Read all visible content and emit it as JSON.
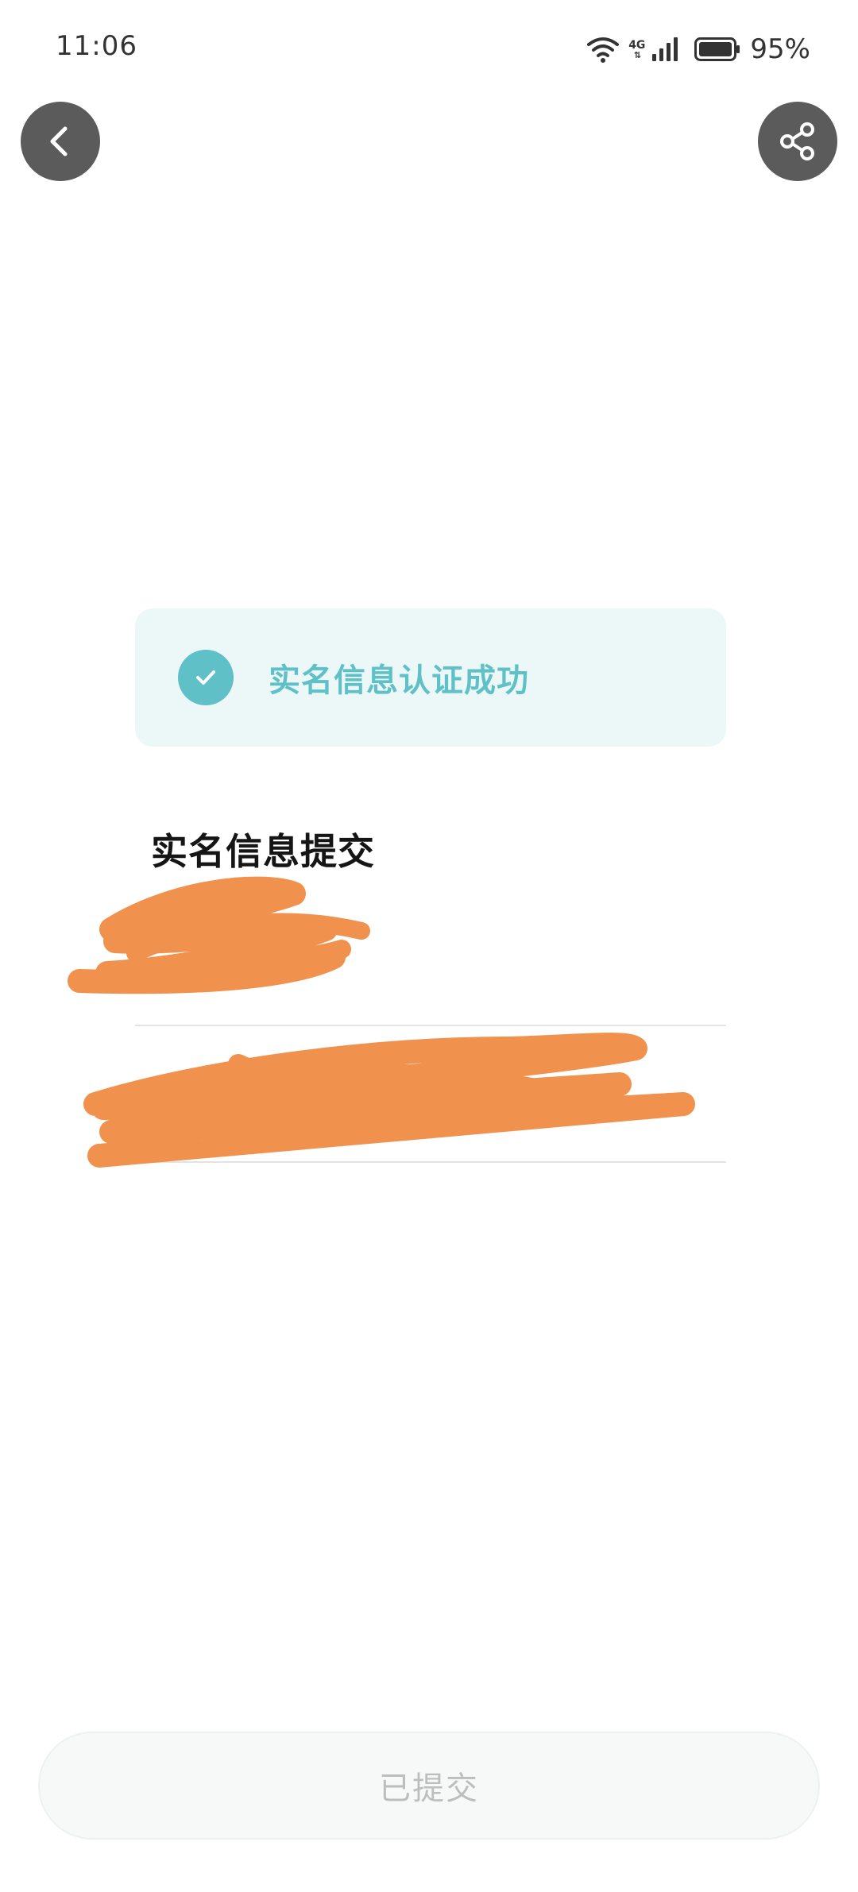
{
  "status_bar": {
    "time": "11:06",
    "network_label": "4G",
    "battery": "95%",
    "icons": [
      "wifi-icon",
      "signal-icon",
      "battery-icon"
    ]
  },
  "header": {
    "back_icon": "chevron-left-icon",
    "share_icon": "share-icon"
  },
  "banner": {
    "text": "实名信息认证成功",
    "icon": "check-icon",
    "accent_color": "#5fc0c7",
    "background_color": "#ecf8f8"
  },
  "section": {
    "title": "实名信息提交"
  },
  "fields": [
    {
      "value": "",
      "redacted": true
    },
    {
      "value": "",
      "redacted": true
    }
  ],
  "redaction_color": "#f0924e",
  "footer": {
    "submit_label": "已提交"
  }
}
